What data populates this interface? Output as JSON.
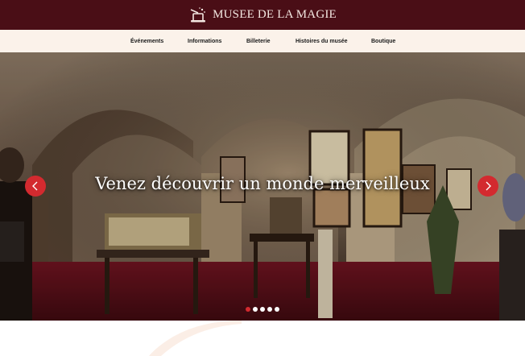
{
  "header": {
    "title": "MUSEE DE LA MAGIE",
    "logo_icon": "magic-hat-icon",
    "background": "#4a0e16"
  },
  "nav": {
    "items": [
      {
        "label": "Événements"
      },
      {
        "label": "Informations"
      },
      {
        "label": "Billeterie"
      },
      {
        "label": "Histoires du musée"
      },
      {
        "label": "Boutique"
      }
    ]
  },
  "hero": {
    "caption": "Venez découvrir un monde merveilleux",
    "prev_icon": "chevron-left-icon",
    "next_icon": "chevron-right-icon",
    "slide_count": 5,
    "active_slide": 1,
    "accent": "#d32a2f"
  }
}
